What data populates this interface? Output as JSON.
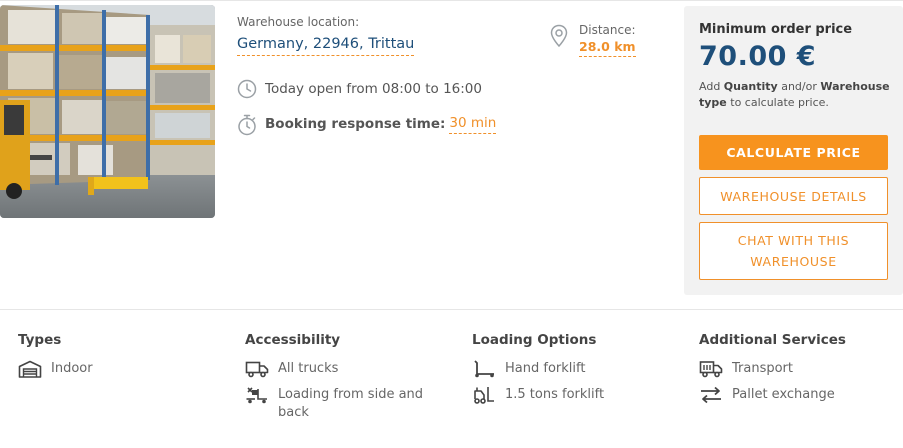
{
  "listing": {
    "location_label": "Warehouse location:",
    "location_value": "Germany, 22946, Trittau",
    "distance_label": "Distance:",
    "distance_value": "28.0 km",
    "hours_text": "Today open from 08:00 to 16:00",
    "response_label": "Booking response time:",
    "response_value": "30 min"
  },
  "price": {
    "label": "Minimum order price",
    "value": "70.00 €",
    "hint_prefix": "Add ",
    "hint_quantity": "Quantity",
    "hint_and": " and/or ",
    "hint_type": "Warehouse type",
    "hint_suffix": " to calculate price.",
    "calculate_button": "CALCULATE PRICE",
    "details_button": "WAREHOUSE DETAILS",
    "chat_button": "CHAT WITH THIS WAREHOUSE"
  },
  "features": {
    "types": {
      "title": "Types",
      "items": [
        "Indoor"
      ]
    },
    "accessibility": {
      "title": "Accessibility",
      "items": [
        "All trucks",
        "Loading from side and back"
      ]
    },
    "loading": {
      "title": "Loading Options",
      "items": [
        "Hand forklift",
        "1.5 tons forklift"
      ]
    },
    "services": {
      "title": "Additional Services",
      "items": [
        "Transport",
        "Pallet exchange"
      ]
    }
  },
  "colors": {
    "accent": "#f7931e",
    "brand_blue": "#1e4f7a",
    "panel_bg": "#f2f2f2"
  },
  "icons": {
    "distance": "map-pin-icon",
    "hours": "clock-icon",
    "response": "stopwatch-icon",
    "indoor": "warehouse-icon",
    "all_trucks": "truck-icon",
    "loading_side_back": "loading-dock-icon",
    "hand_forklift": "hand-pallet-truck-icon",
    "tons_forklift": "forklift-icon",
    "transport": "delivery-truck-icon",
    "pallet_exchange": "exchange-arrows-icon"
  }
}
